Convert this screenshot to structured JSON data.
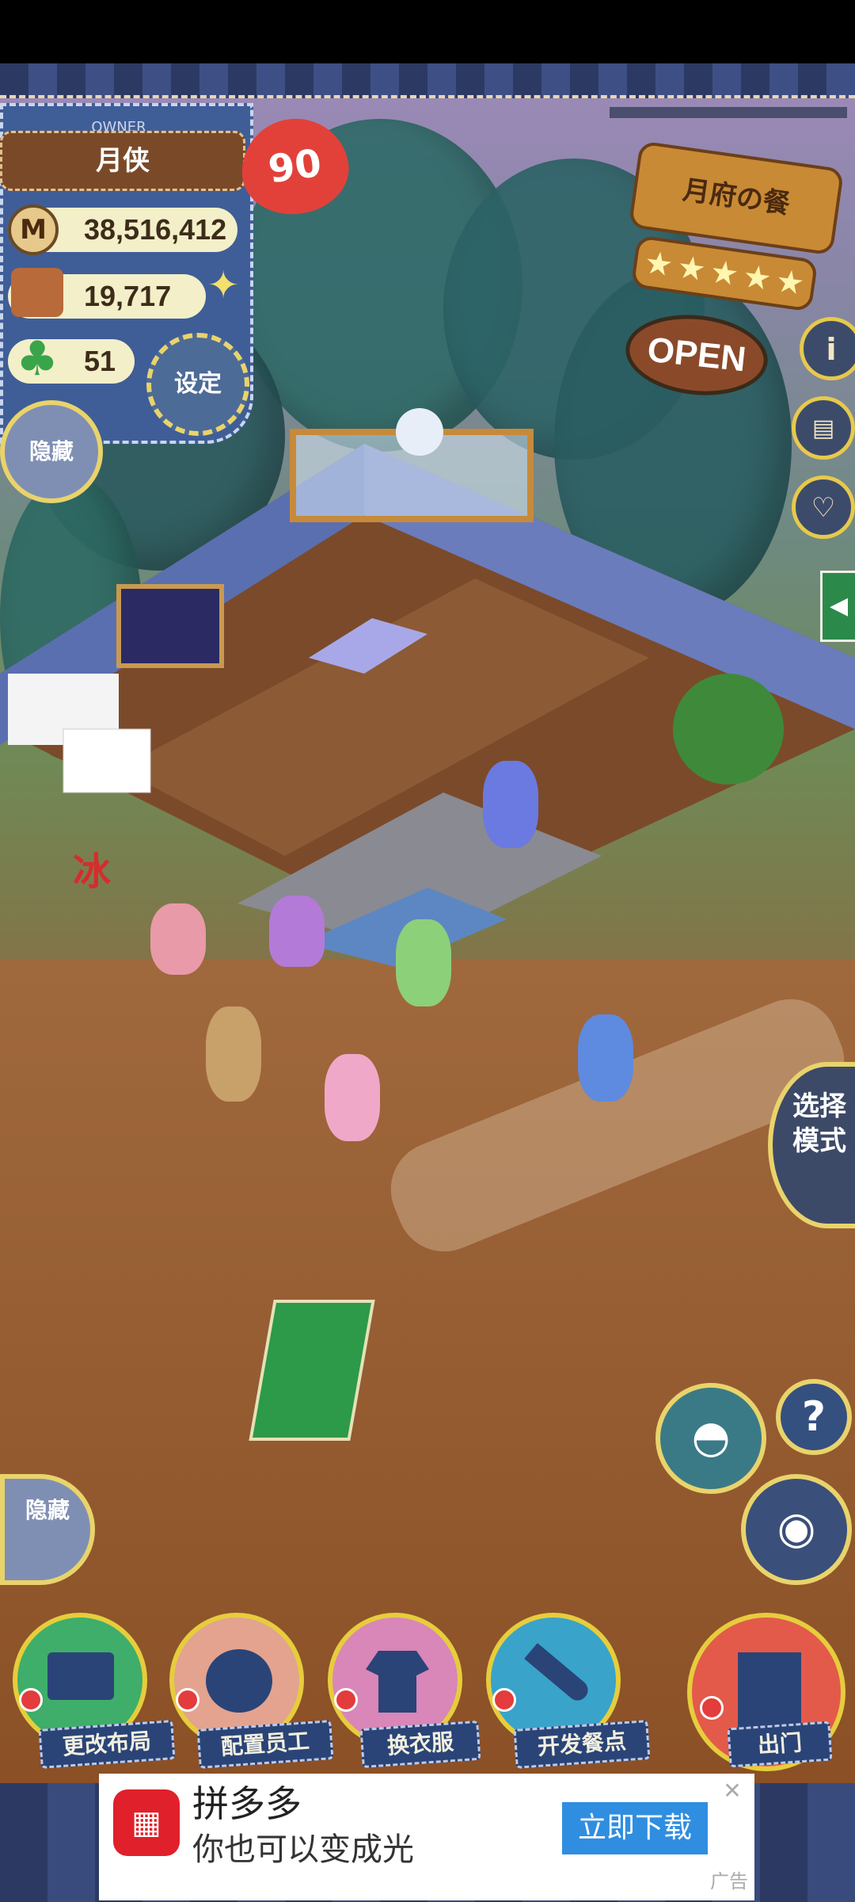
{
  "owner": {
    "header": "OWNER",
    "name": "月侠",
    "level": "90",
    "money": "38,516,412",
    "ingredients": "19,717",
    "clover": "51",
    "settings_label": "设定",
    "hide_label": "隐藏",
    "currency_icon_letter": "M"
  },
  "shop_sign": {
    "name": "月府の餐",
    "stars": 5,
    "open_label": "OPEN"
  },
  "side_buttons": {
    "info": "i",
    "book": "book-icon",
    "favorite": "heart-icon"
  },
  "select_mode_label": "选择模式",
  "bottom_hide_label": "隐藏",
  "ice_label": "冰",
  "nav": [
    {
      "label": "更改布局",
      "icon": "table-icon"
    },
    {
      "label": "配置员工",
      "icon": "bear-icon"
    },
    {
      "label": "换衣服",
      "icon": "shirt-icon"
    },
    {
      "label": "开发餐点",
      "icon": "knife-icon"
    },
    {
      "label": "出门",
      "icon": "door-icon"
    }
  ],
  "tools": {
    "hat": "hat-icon",
    "help": "?",
    "camera": "camera-icon"
  },
  "ad": {
    "title": "拼多多",
    "subtitle": "你也可以变成光",
    "cta": "立即下载",
    "tag": "广告",
    "close": "✕"
  },
  "colors": {
    "accent_gold": "#e6cd3c",
    "denim": "#3f5e97",
    "badge_red": "#e2413a",
    "ad_blue": "#2f8ee0"
  }
}
